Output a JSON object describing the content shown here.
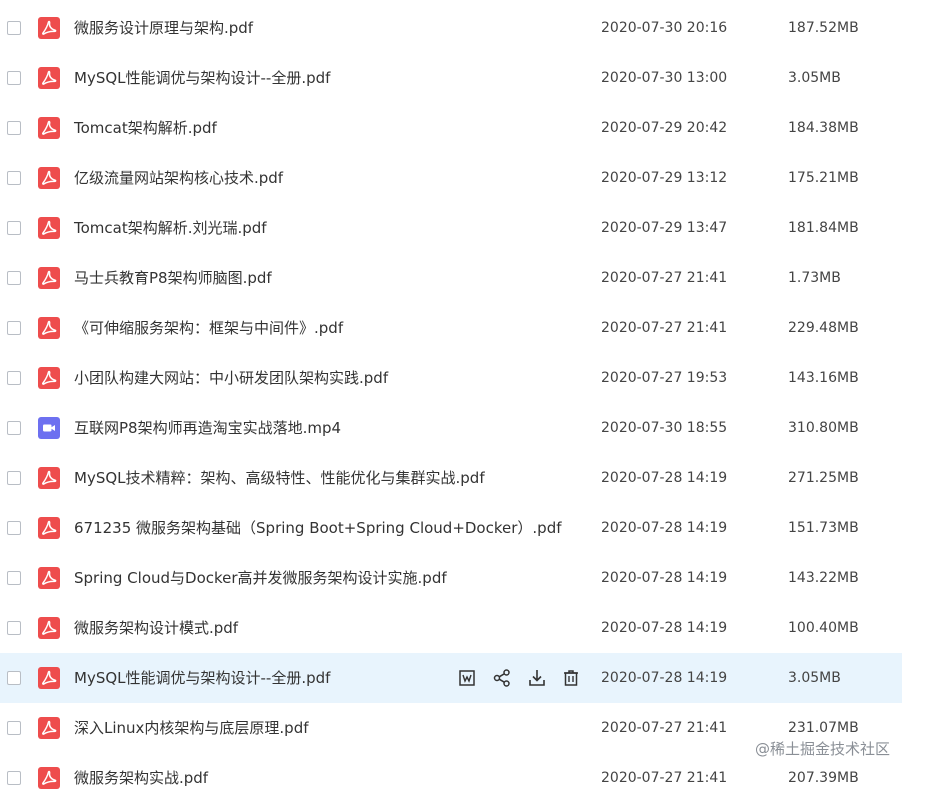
{
  "file_list": {
    "rows": [
      {
        "name": "微服务设计原理与架构.pdf",
        "date": "2020-07-30 20:16",
        "size": "187.52MB",
        "type": "pdf-icon"
      },
      {
        "name": "MySQL性能调优与架构设计--全册.pdf",
        "date": "2020-07-30 13:00",
        "size": "3.05MB",
        "type": "pdf-icon"
      },
      {
        "name": "Tomcat架构解析.pdf",
        "date": "2020-07-29 20:42",
        "size": "184.38MB",
        "type": "pdf-icon"
      },
      {
        "name": "亿级流量网站架构核心技术.pdf",
        "date": "2020-07-29 13:12",
        "size": "175.21MB",
        "type": "pdf-icon"
      },
      {
        "name": "Tomcat架构解析.刘光瑞.pdf",
        "date": "2020-07-29 13:47",
        "size": "181.84MB",
        "type": "pdf-icon"
      },
      {
        "name": "马士兵教育P8架构师脑图.pdf",
        "date": "2020-07-27 21:41",
        "size": "1.73MB",
        "type": "pdf-icon"
      },
      {
        "name": "《可伸缩服务架构：框架与中间件》.pdf",
        "date": "2020-07-27 21:41",
        "size": "229.48MB",
        "type": "pdf-icon"
      },
      {
        "name": "小团队构建大网站：中小研发团队架构实践.pdf",
        "date": "2020-07-27 19:53",
        "size": "143.16MB",
        "type": "pdf-icon"
      },
      {
        "name": "互联网P8架构师再造淘宝实战落地.mp4",
        "date": "2020-07-30 18:55",
        "size": "310.80MB",
        "type": "video-icon"
      },
      {
        "name": "MySQL技术精粹：架构、高级特性、性能优化与集群实战.pdf",
        "date": "2020-07-28 14:19",
        "size": "271.25MB",
        "type": "pdf-icon"
      },
      {
        "name": "671235 微服务架构基础（Spring Boot+Spring Cloud+Docker）.pdf",
        "date": "2020-07-28 14:19",
        "size": "151.73MB",
        "type": "pdf-icon"
      },
      {
        "name": "Spring Cloud与Docker高并发微服务架构设计实施.pdf",
        "date": "2020-07-28 14:19",
        "size": "143.22MB",
        "type": "pdf-icon"
      },
      {
        "name": "微服务架构设计模式.pdf",
        "date": "2020-07-28 14:19",
        "size": "100.40MB",
        "type": "pdf-icon"
      },
      {
        "name": "MySQL性能调优与架构设计--全册.pdf",
        "date": "2020-07-28 14:19",
        "size": "3.05MB",
        "type": "pdf-icon"
      },
      {
        "name": "深入Linux内核架构与底层原理.pdf",
        "date": "2020-07-27 21:41",
        "size": "231.07MB",
        "type": "pdf-icon"
      },
      {
        "name": "微服务架构实战.pdf",
        "date": "2020-07-27 21:41",
        "size": "207.39MB",
        "type": "pdf-icon"
      }
    ],
    "hover_actions": [
      "word-doc-icon",
      "share-icon",
      "download-icon",
      "delete-icon"
    ]
  },
  "watermark": "@稀土掘金技术社区",
  "colors": {
    "pdf": "#ee4d4d",
    "video": "#6d70f0",
    "hover_row": "#e8f4fd"
  }
}
